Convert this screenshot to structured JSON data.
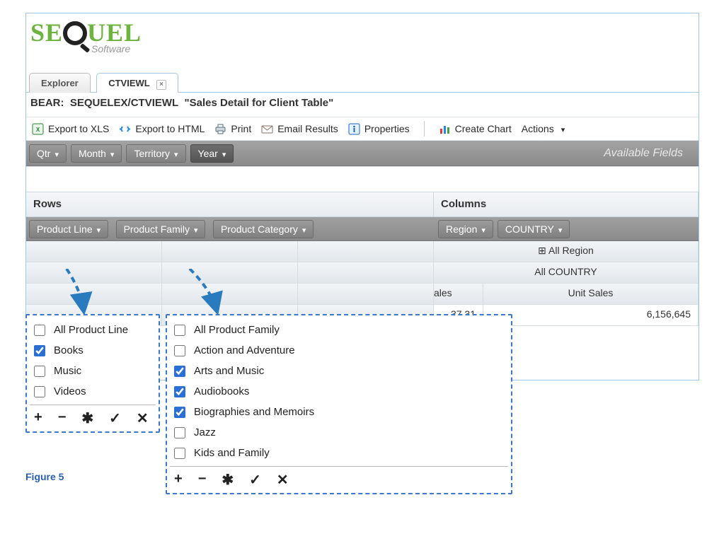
{
  "logo": {
    "line1_a": "SE",
    "line1_b": "UEL",
    "line2": "Software",
    "color_a": "#6db33f",
    "color_b": "#6db33f"
  },
  "tabs": [
    {
      "label": "Explorer",
      "active": false,
      "closable": false
    },
    {
      "label": "CTVIEWL",
      "active": true,
      "closable": true
    }
  ],
  "path": {
    "prefix": "BEAR:",
    "value": "SEQUELEX/CTVIEWL",
    "desc": "\"Sales Detail for Client Table\""
  },
  "toolbar": {
    "export_xls": "Export to XLS",
    "export_html": "Export to HTML",
    "print": "Print",
    "email": "Email Results",
    "properties": "Properties",
    "create_chart": "Create Chart",
    "actions": "Actions"
  },
  "fields_bar": {
    "items": [
      "Qtr",
      "Month",
      "Territory",
      "Year"
    ],
    "dark_index": 3,
    "right_label": "Available Fields"
  },
  "headers": {
    "rows": "Rows",
    "cols": "Columns"
  },
  "row_dims": [
    "Product Line",
    "Product Family",
    "Product Category"
  ],
  "col_dims": [
    "Region",
    "COUNTRY"
  ],
  "col_headers": {
    "all_region": "⊞ All Region",
    "all_country": "All COUNTRY",
    "measure1_partial": "ales",
    "measure2": "Unit Sales",
    "value1_partial": "37.31",
    "value2": "6,156,645"
  },
  "popup_product_line": {
    "items": [
      {
        "label": "All Product Line",
        "checked": false
      },
      {
        "label": "Books",
        "checked": true
      },
      {
        "label": "Music",
        "checked": false
      },
      {
        "label": "Videos",
        "checked": false
      }
    ],
    "actions": [
      "+",
      "−",
      "✱",
      "✓",
      "✕"
    ]
  },
  "popup_product_family": {
    "items": [
      {
        "label": "All Product Family",
        "checked": false
      },
      {
        "label": "Action and Adventure",
        "checked": false
      },
      {
        "label": "Arts and Music",
        "checked": true
      },
      {
        "label": "Audiobooks",
        "checked": true
      },
      {
        "label": "Biographies and Memoirs",
        "checked": true
      },
      {
        "label": "Jazz",
        "checked": false
      },
      {
        "label": "Kids and Family",
        "checked": false
      }
    ],
    "actions": [
      "+",
      "−",
      "✱",
      "✓",
      "✕"
    ]
  },
  "figure_label": "Figure 5",
  "icon_colors": {
    "xls": "#2e7d32",
    "html": "#1e88e5",
    "print": "#546e7a",
    "email": "#8d6e63",
    "props": "#1565c0",
    "chart1": "#e53935",
    "chart2": "#1e88e5",
    "chart3": "#43a047"
  }
}
